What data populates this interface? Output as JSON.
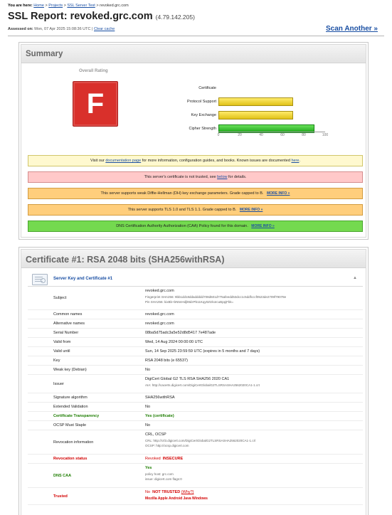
{
  "breadcrumb": {
    "prefix": "You are here:",
    "home": "Home",
    "sep": ">",
    "projects": "Projects",
    "ssl_test": "SSL Server Test",
    "current": "revoked.grc.com"
  },
  "title": {
    "prefix": "SSL Report:",
    "host": "revoked.grc.com",
    "ip": "(4.79.142.205)"
  },
  "assessed": {
    "label": "Assessed on:",
    "date": "Mon, 07 Apr 2025 15:08:36 UTC",
    "sep": "|",
    "clear_cache": "Clear cache"
  },
  "scan_another": "Scan Another »",
  "summary": {
    "heading": "Summary",
    "overall_label": "Overall Rating",
    "grade": "F",
    "grade_color": "#d9302b",
    "bars": [
      {
        "label": "Certificate",
        "value": 0
      },
      {
        "label": "Protocol Support",
        "value": 70
      },
      {
        "label": "Key Exchange",
        "value": 70
      },
      {
        "label": "Cipher Strength",
        "value": 90
      }
    ],
    "scale_ticks": [
      "0",
      "20",
      "40",
      "60",
      "80",
      "100"
    ],
    "notices": {
      "docs": {
        "pre": "Visit our",
        "link": "documentation page",
        "mid": "for more information, configuration guides, and books. Known issues are documented",
        "link2": "here",
        "post": "."
      },
      "untrusted": {
        "pre": "This server's certificate is not trusted, see",
        "link": "below",
        "post": "for details."
      },
      "dh": {
        "text": "This server supports weak Diffie-Hellman (DH) key exchange parameters. Grade capped to B.",
        "more": "MORE INFO »"
      },
      "tls": {
        "text": "This server supports TLS 1.0 and TLS 1.1. Grade capped to B.",
        "more": "MORE INFO »"
      },
      "caa": {
        "text": "DNS Certification Authority Authorization (CAA) Policy found for this domain.",
        "more": "MORE INFO »"
      }
    }
  },
  "certificate": {
    "heading": "Certificate #1: RSA 2048 bits (SHA256withRSA)",
    "sub_title": "Server Key and Certificate #1",
    "collapse_icon": "triangle-up-icon",
    "rows": {
      "subject": {
        "label": "Subject",
        "value": "revoked.grc.com",
        "fingerprint": "Fingerprint SHA256: 9bb1dd18ddaddddd708d601d775afeedd53dcc1c5ddfcccf0523de2709f79078e",
        "pin": "Pin SHA256: kixBb+bN5nHdjl8tdzPb11Kqy0ZIzkoIcuBppjFbk="
      },
      "common_names": {
        "label": "Common names",
        "value": "revoked.grc.com"
      },
      "alt_names": {
        "label": "Alternative names",
        "value": "revoked.grc.com"
      },
      "serial": {
        "label": "Serial Number",
        "value": "08ba5d75adc3a5e52d8d5417 7e487ade"
      },
      "valid_from": {
        "label": "Valid from",
        "value": "Wed, 14 Aug 2024 00:00:00 UTC"
      },
      "valid_until": {
        "label": "Valid until",
        "value": "Sun, 14 Sep 2025 23:59:59 UTC (expires in 5 months and 7 days)"
      },
      "key": {
        "label": "Key",
        "value": "RSA 2048 bits (e 65537)"
      },
      "weak_key": {
        "label": "Weak key (Debian)",
        "value": "No"
      },
      "issuer": {
        "label": "Issuer",
        "value": "DigiCert Global G2 TLS RSA SHA256 2020 CA1",
        "aia": "AIA: http://cacerts.digicert.com/DigiCertGlobalG2TLSRSASHA2562020CA1-1.crt"
      },
      "sig_alg": {
        "label": "Signature algorithm",
        "value": "SHA256withRSA"
      },
      "ev": {
        "label": "Extended Validation",
        "value": "No"
      },
      "ct": {
        "label": "Certificate Transparency",
        "value": "Yes (certificate)"
      },
      "ocsp_staple": {
        "label": "OCSP Must Staple",
        "value": "No"
      },
      "revocation_info": {
        "label": "Revocation information",
        "value": "CRL, OCSP",
        "crl": "CRL: http://crl3.digicert.com/DigiCertGlobalG2TLSRSASHA2562020CA1-1.crl",
        "ocsp": "OCSP: http://ocsp.digicert.com"
      },
      "revocation_status": {
        "label": "Revocation status",
        "value": "Revoked",
        "status": "INSECURE"
      },
      "dns_caa": {
        "label": "DNS CAA",
        "value": "Yes",
        "policy": "policy host: grc.com",
        "issue": "issue: digicert.com flags:0"
      },
      "trusted": {
        "label": "Trusted",
        "value": "No",
        "status": "NOT TRUSTED",
        "why": "(Why?)",
        "stores": "Mozilla  Apple  Android  Java  Windows"
      }
    }
  }
}
